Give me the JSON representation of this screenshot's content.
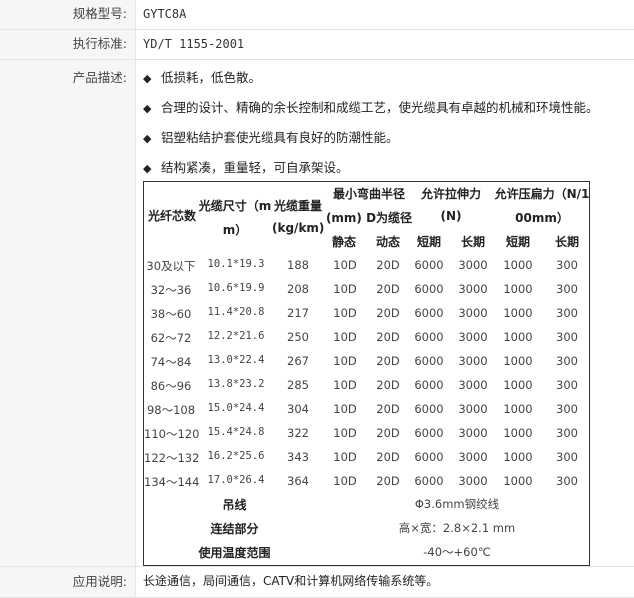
{
  "rows": {
    "model": {
      "label": "规格型号:",
      "value": "GYTC8A"
    },
    "standard": {
      "label": "执行标准:",
      "value": "YD/T 1155-2001"
    },
    "description": {
      "label": "产品描述:",
      "bullet_symbol": "◆",
      "bullets": [
        "低损耗，低色散。",
        "合理的设计、精确的余长控制和成缆工艺，使光缆具有卓越的机械和环境性能。",
        "铝塑粘结护套使光缆具有良好的防潮性能。",
        "结构紧凑，重量轻，可自承架设。"
      ]
    },
    "application": {
      "label": "应用说明:",
      "value": "长途通信，局间通信，CATV和计算机网络传输系统等。"
    }
  },
  "table": {
    "headers": {
      "fiber_count": "光纤芯数",
      "cable_size_line1": "光缆尺寸（m",
      "cable_size_line2": "m）",
      "cable_weight_line1": "光缆重量",
      "cable_weight_line2": "(kg/km)",
      "bend_radius_line1": "最小弯曲半径",
      "bend_radius_line2": "(mm) D为缆径",
      "tensile_line1": "允许拉伸力",
      "tensile_line2": "(N)",
      "crush_line1": "允许压扁力（N/1",
      "crush_line2": "00mm）",
      "static": "静态",
      "dynamic": "动态",
      "short_term_1": "短期",
      "long_term_1": "长期",
      "short_term_2": "短期",
      "long_term_2": "长期"
    },
    "rows": [
      [
        "30及以下",
        "10.1*19.3",
        "188",
        "10D",
        "20D",
        "6000",
        "3000",
        "1000",
        "300"
      ],
      [
        "32～36",
        "10.6*19.9",
        "208",
        "10D",
        "20D",
        "6000",
        "3000",
        "1000",
        "300"
      ],
      [
        "38～60",
        "11.4*20.8",
        "217",
        "10D",
        "20D",
        "6000",
        "3000",
        "1000",
        "300"
      ],
      [
        "62～72",
        "12.2*21.6",
        "250",
        "10D",
        "20D",
        "6000",
        "3000",
        "1000",
        "300"
      ],
      [
        "74～84",
        "13.0*22.4",
        "267",
        "10D",
        "20D",
        "6000",
        "3000",
        "1000",
        "300"
      ],
      [
        "86～96",
        "13.8*23.2",
        "285",
        "10D",
        "20D",
        "6000",
        "3000",
        "1000",
        "300"
      ],
      [
        "98～108",
        "15.0*24.4",
        "304",
        "10D",
        "20D",
        "6000",
        "3000",
        "1000",
        "300"
      ],
      [
        "110～120",
        "15.4*24.8",
        "322",
        "10D",
        "20D",
        "6000",
        "3000",
        "1000",
        "300"
      ],
      [
        "122～132",
        "16.2*25.6",
        "343",
        "10D",
        "20D",
        "6000",
        "3000",
        "1000",
        "300"
      ],
      [
        "134～144",
        "17.0*26.4",
        "364",
        "10D",
        "20D",
        "6000",
        "3000",
        "1000",
        "300"
      ]
    ],
    "footer": [
      {
        "label": "吊线",
        "value": "Φ3.6mm钢绞线"
      },
      {
        "label": "连结部分",
        "value": "高×宽：2.8×2.1 mm"
      },
      {
        "label": "使用温度范围",
        "value": "-40～+60℃"
      }
    ]
  }
}
